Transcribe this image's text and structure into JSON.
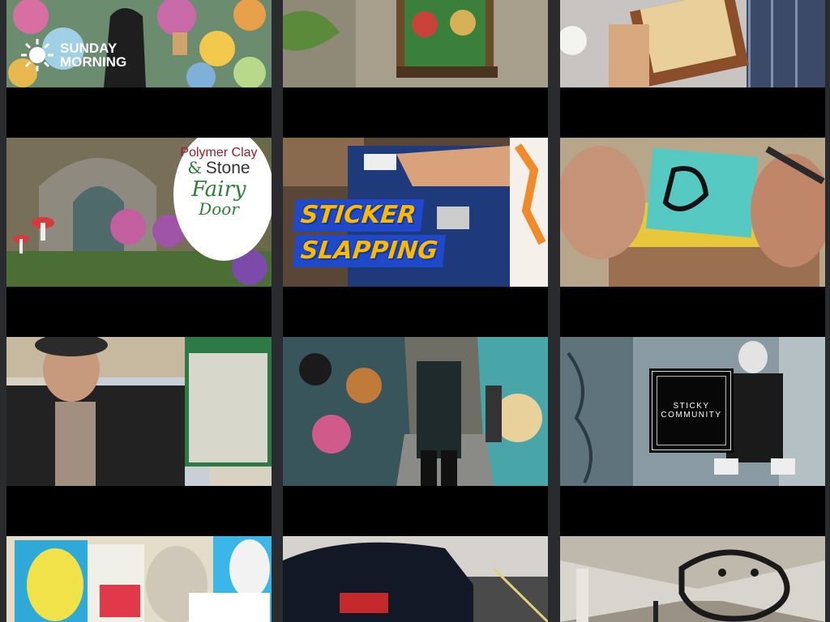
{
  "thumbnails": [
    {
      "name": "sunday-morning",
      "overlay_text": "SUNDAY MORNING"
    },
    {
      "name": "fairy-door-figures"
    },
    {
      "name": "wood-frame"
    },
    {
      "name": "fairy-door",
      "overlay": {
        "line1": "Polymer Clay",
        "amp": "&",
        "line2": "Stone",
        "line3": "Fairy",
        "line4": "Door"
      }
    },
    {
      "name": "sticker-slapping",
      "overlay": {
        "line1": "STICKER",
        "line2": "SLAPPING"
      }
    },
    {
      "name": "sticker-drawing"
    },
    {
      "name": "man-sticker-box"
    },
    {
      "name": "graffiti-alley"
    },
    {
      "name": "sticky-community",
      "overlay": {
        "line1": "STICKY",
        "line2": "COMMUNITY"
      }
    },
    {
      "name": "priority-mail-stickers"
    },
    {
      "name": "car-street"
    },
    {
      "name": "subway-tunnel"
    }
  ]
}
